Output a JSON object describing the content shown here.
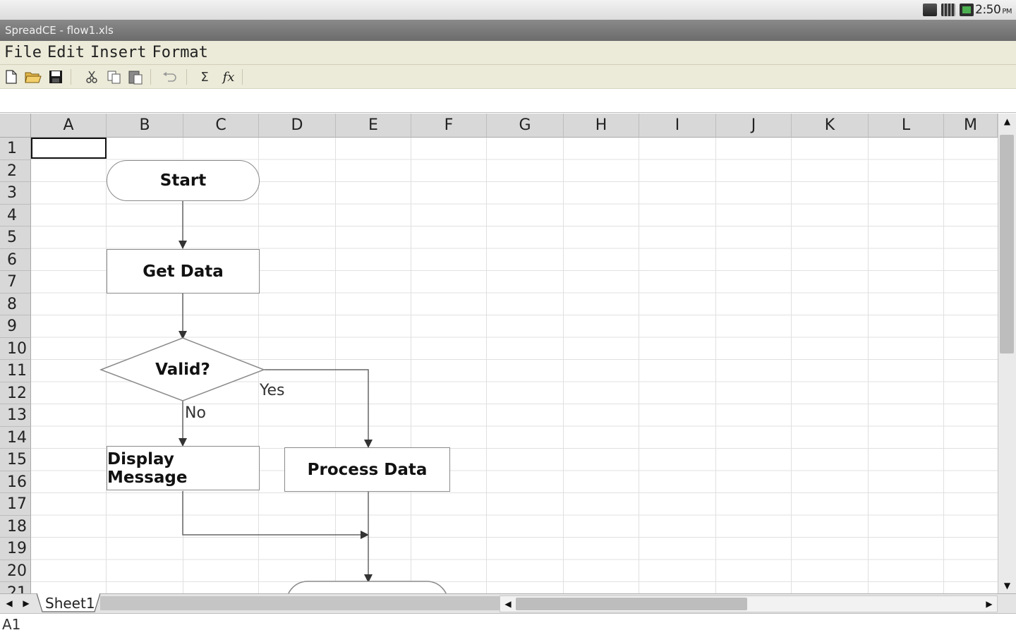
{
  "status": {
    "time": "2:50",
    "ampm": "PM",
    "icons": [
      "sd-card-icon",
      "signal-icon",
      "battery-icon"
    ]
  },
  "app": {
    "title": "SpreadCE - flow1.xls"
  },
  "menu": [
    "File",
    "Edit",
    "Insert",
    "Format"
  ],
  "toolbar": {
    "icons": [
      "new-document-icon",
      "open-folder-icon",
      "save-icon",
      "cut-icon",
      "copy-icon",
      "paste-icon",
      "undo-icon",
      "sum-icon",
      "function-icon"
    ],
    "sum_label": "Σ",
    "fx_label": "fx"
  },
  "formula": {
    "value": ""
  },
  "grid": {
    "columns": [
      "A",
      "B",
      "C",
      "D",
      "E",
      "F",
      "G",
      "H",
      "I",
      "J",
      "K",
      "L",
      "M"
    ],
    "rows": [
      "1",
      "2",
      "3",
      "4",
      "5",
      "6",
      "7",
      "8",
      "9",
      "10",
      "11",
      "12",
      "13",
      "14",
      "15",
      "16",
      "17",
      "18",
      "19",
      "20",
      "21"
    ],
    "selected_cell": "A1"
  },
  "flowchart": {
    "start": "Start",
    "get_data": "Get Data",
    "decision": "Valid?",
    "yes_label": "Yes",
    "no_label": "No",
    "display_message": "Display Message",
    "process_data": "Process Data"
  },
  "sheets": [
    "Sheet1"
  ],
  "cell_ref": "A1"
}
